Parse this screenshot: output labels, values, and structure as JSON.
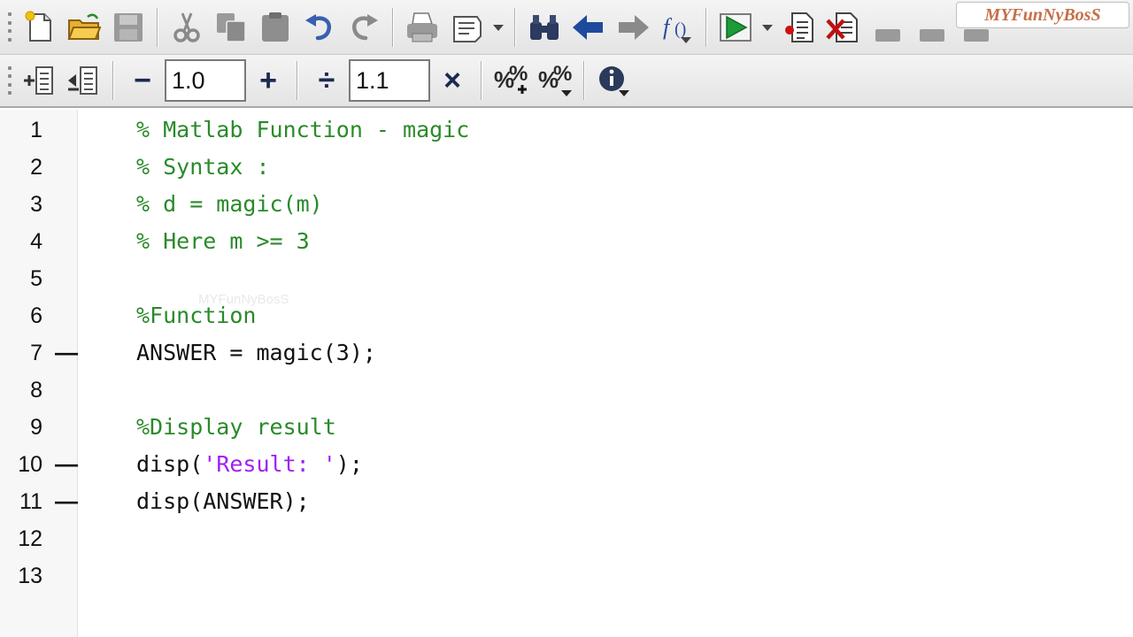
{
  "toolbar1": {
    "buttons": [
      {
        "name": "new-file",
        "icon": "new-file-icon"
      },
      {
        "name": "open-file",
        "icon": "open-folder-icon"
      },
      {
        "name": "save",
        "icon": "save-icon"
      },
      {
        "name": "cut",
        "icon": "scissors-icon"
      },
      {
        "name": "copy",
        "icon": "copy-icon"
      },
      {
        "name": "paste",
        "icon": "paste-icon"
      },
      {
        "name": "undo",
        "icon": "undo-icon"
      },
      {
        "name": "redo",
        "icon": "redo-icon"
      },
      {
        "name": "print",
        "icon": "printer-icon"
      },
      {
        "name": "print-selection",
        "icon": "print-selection-icon"
      },
      {
        "name": "find",
        "icon": "binoculars-icon"
      },
      {
        "name": "go-back",
        "icon": "arrow-left-icon"
      },
      {
        "name": "go-forward",
        "icon": "arrow-right-icon"
      },
      {
        "name": "function-browser",
        "icon": "fx-icon"
      },
      {
        "name": "run",
        "icon": "run-icon"
      },
      {
        "name": "set-breakpoint",
        "icon": "breakpoint-icon"
      },
      {
        "name": "clear-breakpoints",
        "icon": "clear-breakpoints-icon"
      }
    ]
  },
  "toolbar2": {
    "decrement_label": "−",
    "increment_label": "+",
    "increment_value": "1.0",
    "divide_label": "÷",
    "multiply_label": "×",
    "scale_value": "1.1"
  },
  "watermark": "MYFunNyBosS",
  "editor": {
    "ghost_text": "MYFunNyBosS",
    "lines": [
      {
        "num": "1",
        "marker": "",
        "type": "comment",
        "text": "% Matlab Function - magic"
      },
      {
        "num": "2",
        "marker": "",
        "type": "comment",
        "text": "% Syntax :"
      },
      {
        "num": "3",
        "marker": "",
        "type": "comment",
        "text": "% d = magic(m)"
      },
      {
        "num": "4",
        "marker": "",
        "type": "comment",
        "text": "% Here m >= 3"
      },
      {
        "num": "5",
        "marker": "",
        "type": "blank",
        "text": ""
      },
      {
        "num": "6",
        "marker": "",
        "type": "comment",
        "text": "%Function"
      },
      {
        "num": "7",
        "marker": "—",
        "type": "code",
        "text": "ANSWER = magic(3);"
      },
      {
        "num": "8",
        "marker": "",
        "type": "blank",
        "text": ""
      },
      {
        "num": "9",
        "marker": "",
        "type": "comment",
        "text": "%Display result"
      },
      {
        "num": "10",
        "marker": "—",
        "type": "mixed",
        "pre": "disp(",
        "str": "'Result: '",
        "post": ");"
      },
      {
        "num": "11",
        "marker": "—",
        "type": "code",
        "text": "disp(ANSWER);"
      },
      {
        "num": "12",
        "marker": "",
        "type": "blank",
        "text": ""
      },
      {
        "num": "13",
        "marker": "",
        "type": "blank",
        "text": ""
      }
    ]
  },
  "colors": {
    "comment": "#2a8a2a",
    "string": "#a020f0",
    "code": "#111111",
    "watermark": "#c56f47"
  }
}
